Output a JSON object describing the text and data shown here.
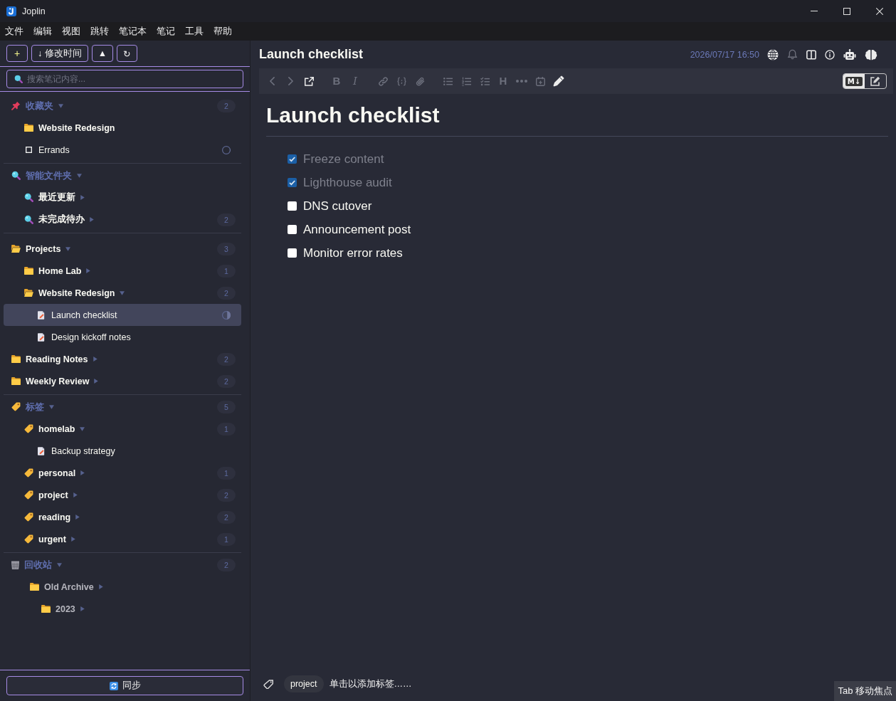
{
  "window": {
    "title": "Joplin"
  },
  "menu": [
    "文件",
    "编辑",
    "视图",
    "跳转",
    "笔记本",
    "笔记",
    "工具",
    "帮助"
  ],
  "sidebar": {
    "toolbar": [
      {
        "kind": "new",
        "label": "+"
      },
      {
        "kind": "sort",
        "label": "↓ 修改时间"
      },
      {
        "kind": "order",
        "label": "▲"
      },
      {
        "kind": "toggle",
        "label": "↻"
      }
    ],
    "search": {
      "placeholder": "搜索笔记内容..."
    },
    "sections": [
      {
        "kind": "favorites",
        "label": "收藏夹",
        "expanded": true,
        "count": "2",
        "items": [
          {
            "kind": "folder",
            "label": "Website Redesign",
            "selected": false
          },
          {
            "kind": "todo",
            "label": "Errands",
            "checked": false,
            "level": 0,
            "selected": false
          }
        ]
      },
      {
        "kind": "smart",
        "label": "智能文件夹",
        "expanded": true,
        "items": [
          {
            "kind": "search",
            "label": "最近更新",
            "expanded": false,
            "selected": false
          },
          {
            "kind": "search",
            "label": "未完成待办",
            "expanded": false,
            "count": "2",
            "selected": false
          }
        ]
      },
      {
        "kind": "notebooks",
        "items": [
          {
            "kind": "folder",
            "label": "Projects",
            "expanded": true,
            "count": "3",
            "selected": false,
            "children": [
              {
                "kind": "folder",
                "label": "Home Lab",
                "expanded": false,
                "count": "1",
                "selected": false
              },
              {
                "kind": "folder",
                "label": "Website Redesign",
                "expanded": true,
                "count": "2",
                "selected": false,
                "children": [
                  {
                    "kind": "note",
                    "label": "Launch checklist",
                    "level": 0.4,
                    "selected": true
                  },
                  {
                    "kind": "note",
                    "label": "Design kickoff notes",
                    "selected": false
                  }
                ]
              }
            ]
          },
          {
            "kind": "folder",
            "label": "Reading Notes",
            "expanded": false,
            "count": "2",
            "selected": false
          },
          {
            "kind": "folder",
            "label": "Weekly Review",
            "expanded": false,
            "count": "2",
            "selected": false
          }
        ]
      },
      {
        "kind": "tags",
        "label": "标签",
        "expanded": true,
        "count": "5",
        "items": [
          {
            "kind": "tag",
            "label": "homelab",
            "expanded": true,
            "count": "1",
            "selected": false,
            "children": [
              {
                "kind": "note",
                "label": "Backup strategy",
                "selected": false
              }
            ]
          },
          {
            "kind": "tag",
            "label": "personal",
            "expanded": false,
            "count": "1",
            "selected": false
          },
          {
            "kind": "tag",
            "label": "project",
            "expanded": false,
            "count": "2",
            "selected": false
          },
          {
            "kind": "tag",
            "label": "reading",
            "expanded": false,
            "count": "2",
            "selected": false
          },
          {
            "kind": "tag",
            "label": "urgent",
            "expanded": false,
            "count": "1",
            "selected": false
          }
        ]
      },
      {
        "kind": "trash",
        "label": "回收站",
        "expanded": true,
        "count": "2",
        "items": [
          {
            "kind": "folder",
            "label": "Old Archive",
            "expanded": false,
            "selected": false,
            "children": [
              {
                "kind": "folder",
                "label": "2023",
                "expanded": false,
                "selected": false
              }
            ]
          }
        ]
      }
    ],
    "sync_button": {
      "label": "同步"
    }
  },
  "editor": {
    "title": "Launch checklist",
    "updated": "2026/07/17 16:50",
    "note_actions": [
      {
        "kind": "globe",
        "disabled": false
      },
      {
        "kind": "alarm",
        "disabled": true
      },
      {
        "kind": "layout",
        "disabled": false
      },
      {
        "kind": "info",
        "disabled": false
      },
      {
        "kind": "robot",
        "disabled": false
      },
      {
        "kind": "brain",
        "disabled": false
      }
    ],
    "toolbar_groups": [
      [
        {
          "kind": "back",
          "disabled": true
        },
        {
          "kind": "forward",
          "disabled": true
        },
        {
          "kind": "external",
          "disabled": false
        }
      ],
      [
        {
          "kind": "bold",
          "label": "B",
          "disabled": true
        },
        {
          "kind": "italic",
          "label": "I",
          "disabled": true
        }
      ],
      [
        {
          "kind": "link",
          "disabled": true
        },
        {
          "kind": "code",
          "disabled": true
        },
        {
          "kind": "attach",
          "disabled": true
        }
      ],
      [
        {
          "kind": "bullets",
          "disabled": true
        },
        {
          "kind": "numbers",
          "disabled": true
        },
        {
          "kind": "checklist",
          "disabled": true
        },
        {
          "kind": "heading",
          "label": "H",
          "disabled": true
        },
        {
          "kind": "rule",
          "disabled": true
        },
        {
          "kind": "insert_date",
          "disabled": true
        },
        {
          "kind": "spell",
          "disabled": false
        }
      ]
    ],
    "view_toggle": [
      {
        "kind": "markdown",
        "label": "M↓",
        "selected": true
      },
      {
        "kind": "rich_text",
        "selected": false
      }
    ],
    "heading": "Launch checklist",
    "checklist": [
      {
        "label": "Freeze content",
        "checked": true
      },
      {
        "label": "Lighthouse audit",
        "checked": true
      },
      {
        "label": "DNS cutover",
        "checked": false
      },
      {
        "label": "Announcement post",
        "checked": false
      },
      {
        "label": "Monitor error rates",
        "checked": false
      }
    ],
    "tag_bar": {
      "tags": [
        "project"
      ],
      "add_prompt": "单击以添加标签……"
    }
  },
  "focus_hint": "Tab 移动焦点"
}
